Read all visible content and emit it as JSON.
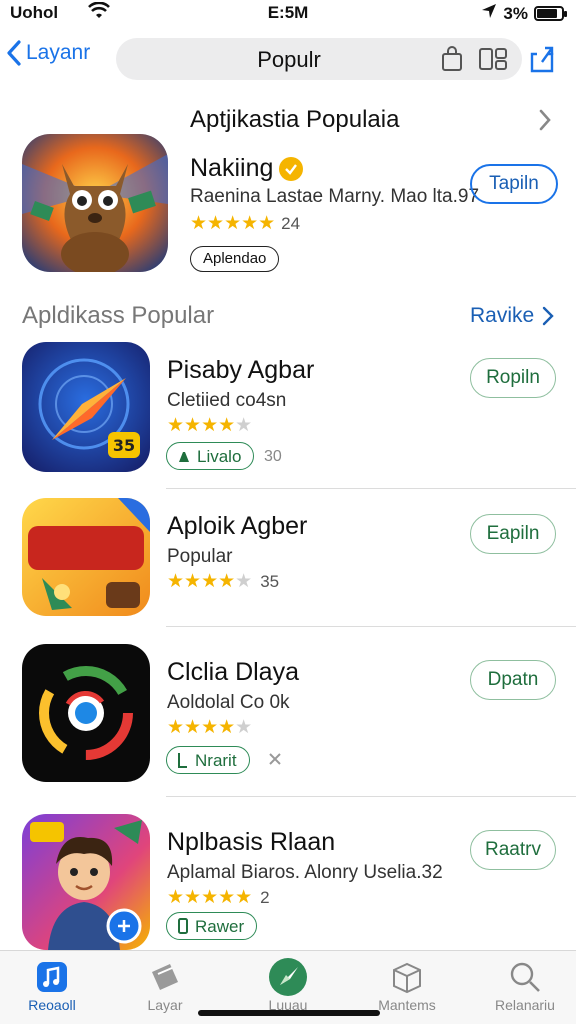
{
  "status": {
    "carrier": "Uohol",
    "time": "E:5M",
    "battery": "3%",
    "battery_level": 0.85
  },
  "nav": {
    "back_label": "Layanr",
    "title": "Populr"
  },
  "featured": {
    "section_title": "Aptjikastia Populaia",
    "app_name": "Nakiing",
    "subtitle": "Raenina Lastae Marny. Mao lta.97",
    "stars": 5,
    "rating_count": "24",
    "tag": "Aplendao",
    "get_label": "Tapiln"
  },
  "section": {
    "title": "Apldikass Popular",
    "link": "Ravike"
  },
  "apps": [
    {
      "name": "Pisaby Agbar",
      "subtitle": "Cletiied co4sn",
      "stars": 4,
      "rating_count": "",
      "tag": "Livalo",
      "tag_extra": "30",
      "get_label": "Ropiln"
    },
    {
      "name": "Aploik Agber",
      "subtitle": "Popular",
      "stars": 4,
      "rating_count": "35",
      "tag": "",
      "tag_extra": "",
      "get_label": "Eapiln"
    },
    {
      "name": "Clclia Dlaya",
      "subtitle": "Aoldolal Co 0k",
      "stars": 4,
      "rating_count": "",
      "tag": "Nrarit",
      "tag_extra": "",
      "get_label": "Dpatn"
    },
    {
      "name": "Nplbasis Rlaan",
      "subtitle": "Aplamal Biaros.  Alonry Uselia.32",
      "stars": 5,
      "rating_count": "2",
      "tag": "Rawer",
      "tag_extra": "",
      "get_label": "Raatrv"
    }
  ],
  "tabs": [
    {
      "label": "Reoaoll",
      "icon": "music-icon",
      "active": true
    },
    {
      "label": "Layar",
      "icon": "games-icon",
      "active": false
    },
    {
      "label": "Luuau",
      "icon": "compass-icon",
      "active": false
    },
    {
      "label": "Mantems",
      "icon": "box-icon",
      "active": false
    },
    {
      "label": "Relanariu",
      "icon": "search-icon",
      "active": false
    }
  ],
  "colors": {
    "accent_blue": "#1a73e8",
    "accent_green": "#2e8b57",
    "star": "#f5b400"
  }
}
